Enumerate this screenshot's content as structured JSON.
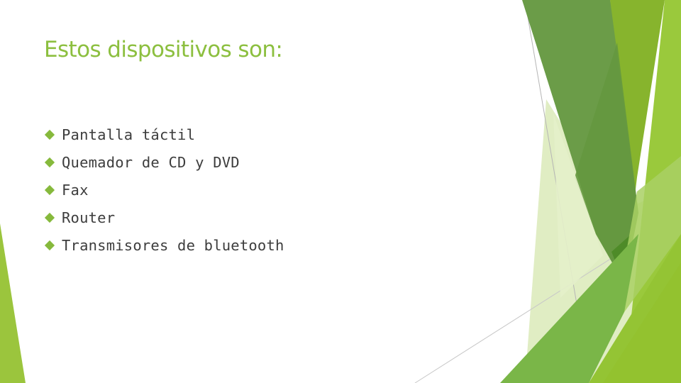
{
  "slide": {
    "title": "Estos dispositivos son:",
    "bullets": [
      {
        "text": "Pantalla táctil"
      },
      {
        "text": "Quemador de CD y DVD"
      },
      {
        "text": "Fax"
      },
      {
        "text": "Router"
      },
      {
        "text": "Transmisores de bluetooth"
      }
    ],
    "bullet_icon": "diamond-bullet-icon"
  },
  "theme": {
    "title_color": "#8cbf3f",
    "text_color": "#3d3d3d",
    "accent_colors": [
      "#6a9b46",
      "#87b32c",
      "#99c83c",
      "#7ab648",
      "#d6e8ae",
      "#4d8a26"
    ]
  }
}
